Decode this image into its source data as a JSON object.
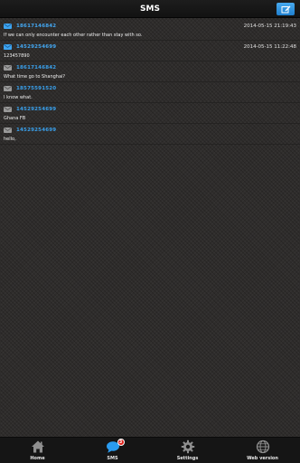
{
  "header": {
    "title": "SMS"
  },
  "messages": [
    {
      "phone": "18617146842",
      "time": "2014-05-15 21:19:43",
      "body": "If we can only encounter each other rather than stay with so.",
      "state": "unread"
    },
    {
      "phone": "14529254699",
      "time": "2014-05-15 11:22:48",
      "body": "123457890",
      "state": "unread"
    },
    {
      "phone": "18617146842",
      "time": "",
      "body": "What time go to Shanghai?",
      "state": "read"
    },
    {
      "phone": "18575591520",
      "time": "",
      "body": "I know what.",
      "state": "read"
    },
    {
      "phone": "14529254699",
      "time": "",
      "body": "Ghana FB",
      "state": "read"
    },
    {
      "phone": "14529254699",
      "time": "",
      "body": "hello,",
      "state": "read"
    }
  ],
  "tabbar": {
    "items": [
      {
        "label": "Home",
        "icon": "home-icon"
      },
      {
        "label": "SMS",
        "icon": "chat-bubble-icon",
        "badge": "3"
      },
      {
        "label": "Settings",
        "icon": "gear-icon"
      },
      {
        "label": "Web version",
        "icon": "globe-icon"
      }
    ]
  },
  "colors": {
    "accent": "#3a9fee",
    "badge": "#e0231c",
    "header_bg": "#151515"
  }
}
